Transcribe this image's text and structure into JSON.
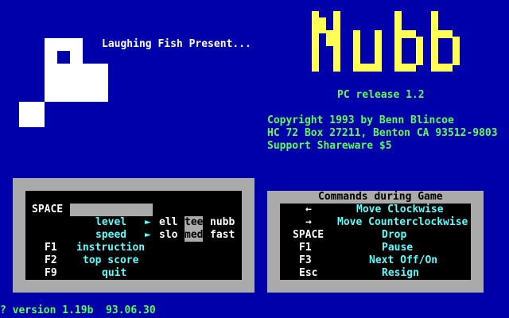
{
  "header": {
    "presenter": "Laughing Fish Present...",
    "title_letters": [
      "N",
      "u",
      "b",
      "b"
    ],
    "release": "PC release 1.2"
  },
  "credits": {
    "line1": "Copyright 1993 by Benn Blincoe",
    "line2": "HC 72 Box 27211, Benton CA 93512-9803",
    "line3": "Support Shareware  $5"
  },
  "menu": {
    "space_label": "SPACE",
    "level_label": "level",
    "level_options": [
      "ell",
      "tee",
      "nubb"
    ],
    "level_selected": "tee",
    "speed_label": "speed",
    "speed_options": [
      "slo",
      "med",
      "fast"
    ],
    "speed_selected": "med",
    "items": [
      {
        "key": "F1",
        "label": "instruction"
      },
      {
        "key": "F2",
        "label": "top score"
      },
      {
        "key": "F9",
        "label": "quit"
      }
    ]
  },
  "commands": {
    "title": "Commands during Game",
    "rows": [
      {
        "key": "←",
        "action": "Move Clockwise"
      },
      {
        "key": "→",
        "action": "Move Counterclockwise"
      },
      {
        "key": "SPACE",
        "action": "Drop"
      },
      {
        "key": "F1",
        "action": "Pause"
      },
      {
        "key": "F3",
        "action": "Next Off/On"
      },
      {
        "key": "Esc",
        "action": "Resign"
      }
    ]
  },
  "footer": {
    "version": "? version 1.19b  93.06.30"
  },
  "colors": {
    "background": "#0000aa",
    "panel_frame": "#aaaaaa",
    "title_yellow": "#ffff55",
    "text_green": "#55ff55",
    "text_cyan": "#55ffff"
  }
}
